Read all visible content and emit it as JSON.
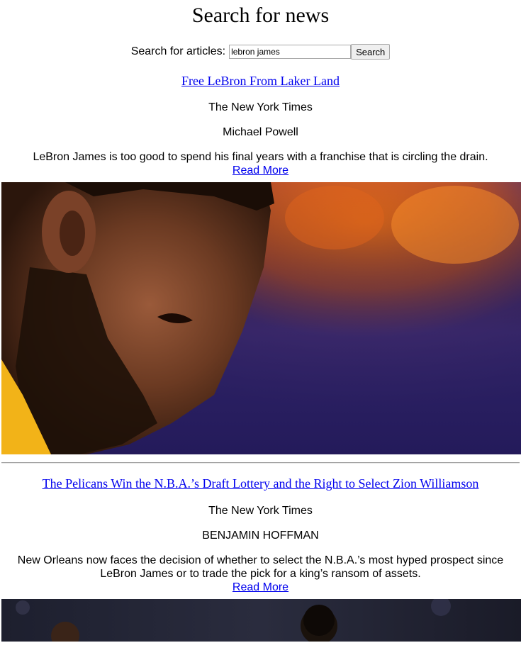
{
  "header": {
    "title": "Search for news"
  },
  "search": {
    "label": "Search for articles:",
    "value": "lebron james",
    "button_label": "Search"
  },
  "articles": [
    {
      "title": "Free LeBron From Laker Land",
      "source": "The New York Times",
      "author": "Michael Powell",
      "summary": "LeBron James is too good to spend his final years with a franchise that is circling the drain.",
      "read_more": "Read More"
    },
    {
      "title": "The Pelicans Win the N.B.A.’s Draft Lottery and the Right to Select Zion Williamson",
      "source": "The New York Times",
      "author": "BENJAMIN HOFFMAN",
      "summary": "New Orleans now faces the decision of whether to select the N.B.A.’s most hyped prospect since LeBron James or to trade the pick for a king’s ransom of assets.",
      "read_more": "Read More"
    }
  ],
  "colors": {
    "link": "#0000ee",
    "divider": "#a0a0a0"
  }
}
